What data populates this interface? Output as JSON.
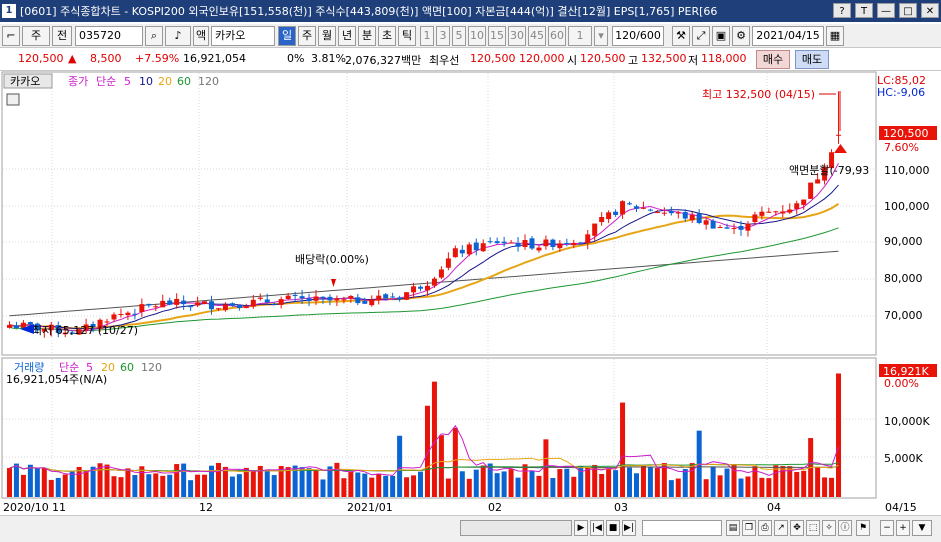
{
  "window": {
    "number": "1",
    "title": "[0601] 주식종합차트 - KOSPI200 외국인보유[151,558(천)] 주식수[443,809(천)] 액면[100] 자본금[444(억)] 결산[12월] EPS[1,765] PER[66",
    "buttons": [
      "?",
      "T",
      "—",
      "□",
      "✕"
    ]
  },
  "toolbar": {
    "market": "주",
    "mode": "전",
    "code": "035720",
    "name_prefix": "액",
    "name": "카카오",
    "periods": [
      "일",
      "주",
      "월",
      "년",
      "분",
      "초",
      "틱"
    ],
    "active_period": "일",
    "intervals": [
      "1",
      "3",
      "5",
      "10",
      "15",
      "30",
      "45",
      "60"
    ],
    "count": "1",
    "range": "120/600",
    "date": "2021/04/15"
  },
  "pricebar": {
    "price": "120,500",
    "change_arrow": "▲",
    "change": "8,500",
    "change_pct": "+7.59%",
    "volume": "16,921,054",
    "zero_pct": "0%",
    "turnover_pct": "3.81%",
    "amount": "2,076,327백만",
    "best_label": "최우선",
    "best_ask": "120,500",
    "best_bid": "120,000",
    "open_label": "시",
    "open": "120,500",
    "high_label": "고",
    "high": "132,500",
    "low_label": "저",
    "low": "118,000",
    "buy_label": "매수",
    "sell_label": "매도"
  },
  "chart": {
    "name_tab": "카카오",
    "ma_legend": [
      "종가",
      "단순",
      "5",
      "10",
      "20",
      "60",
      "120"
    ],
    "lc": "LC:85,02",
    "hc": "HC:-9,06",
    "high_annotation": "최고 132,500 (04/15)",
    "low_annotation": "최저 65,127 (10/27)",
    "dividend_annotation": "배당락(0.00%)",
    "split_annotation": "액면분할(-79,93",
    "current_price_label": "120,500",
    "current_pct_label": "7.60%",
    "y_ticks": [
      "110,000",
      "100,000",
      "90,000",
      "80,000",
      "70,000"
    ],
    "volume_legend": [
      "거래량",
      "단순",
      "5",
      "20",
      "60",
      "120"
    ],
    "volume_value": "16,921,054주(N/A)",
    "volume_current_label": "16,921K",
    "volume_pct_label": "0.00%",
    "volume_ticks": [
      "10,000K",
      "5,000K"
    ],
    "x_labels": [
      "2020/10",
      "11",
      "12",
      "2021/01",
      "02",
      "03",
      "04"
    ],
    "x_right_label": "04/15",
    "colors": {
      "up": "#e8140a",
      "down": "#0a64d2",
      "ma5": "#cc1ecc",
      "ma10": "#14148c",
      "ma20": "#e6a514",
      "ma60": "#1e9632",
      "ma120": "#555555",
      "grid": "#d8d8d8"
    }
  },
  "chart_data": {
    "type": "candlestick",
    "title": "카카오 (035720)",
    "series": [
      {
        "name": "종가",
        "type": "candlestick"
      },
      {
        "name": "5",
        "type": "line"
      },
      {
        "name": "10",
        "type": "line"
      },
      {
        "name": "20",
        "type": "line"
      },
      {
        "name": "60",
        "type": "line"
      },
      {
        "name": "120",
        "type": "line"
      },
      {
        "name": "거래량",
        "type": "bar"
      }
    ],
    "x_range": [
      "2020/10",
      "2021/04/15"
    ],
    "y_range": [
      64000,
      134000
    ],
    "last_close": 120500,
    "period_high": 132500,
    "period_low": 65127,
    "last_volume": 16921054,
    "monthly_closes": [
      {
        "x": "2020/10",
        "close": 67000
      },
      {
        "x": "11",
        "close": 74000
      },
      {
        "x": "12",
        "close": 75500
      },
      {
        "x": "2021/01",
        "close": 90000
      },
      {
        "x": "02",
        "close": 96000
      },
      {
        "x": "03",
        "close": 95000
      },
      {
        "x": "04",
        "close": 120500
      }
    ]
  },
  "bottom": {
    "buttons": [
      "◀",
      "▶",
      "|◀",
      "■",
      "▶|",
      "−",
      "+",
      "▼"
    ]
  }
}
